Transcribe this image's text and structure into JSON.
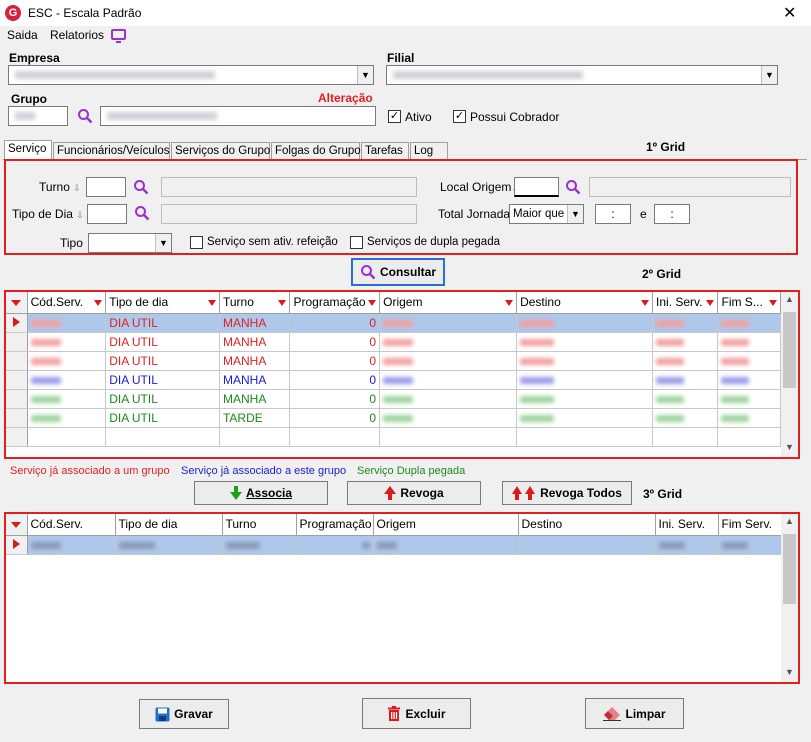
{
  "window": {
    "title": "ESC - Escala Padrão",
    "app_icon_letter": "G",
    "close_glyph": "✕"
  },
  "menu": {
    "items": [
      "Saida",
      "Relatorios"
    ]
  },
  "header": {
    "empresa_label": "Empresa",
    "filial_label": "Filial",
    "grupo_label": "Grupo",
    "alteracao_label": "Alteração",
    "ativo_label": "Ativo",
    "ativo_checked": true,
    "possui_cobrador_label": "Possui Cobrador",
    "possui_cobrador_checked": true
  },
  "tabs": [
    "Serviço",
    "Funcionários/Veículos",
    "Serviços do Grupo",
    "Folgas do Grupo",
    "Tarefas",
    "Log"
  ],
  "active_tab": "Serviço",
  "filters": {
    "grid_label": "1º Grid",
    "turno_label": "Turno",
    "tipo_dia_label": "Tipo de Dia",
    "tipo_label": "Tipo",
    "local_origem_label": "Local Origem",
    "total_jornada_label": "Total Jornada",
    "total_jornada_operator": "Maior que",
    "time_from": ":",
    "e_label": "e",
    "time_to": ":",
    "sem_ativ_label": "Serviço sem ativ. refeição",
    "dupla_pegada_label": "Serviços de dupla pegada"
  },
  "consultar_label": "Consultar",
  "grid2": {
    "label": "2º Grid",
    "columns": [
      "Cód.Serv.",
      "Tipo de dia",
      "Turno",
      "Programação",
      "Origem",
      "Destino",
      "Ini. Serv.",
      "Fim S..."
    ],
    "rows": [
      {
        "tipo": "DIA UTIL",
        "turno": "MANHA",
        "prog": "0",
        "color": "red",
        "selected": true
      },
      {
        "tipo": "DIA UTIL",
        "turno": "MANHA",
        "prog": "0",
        "color": "red",
        "selected": false
      },
      {
        "tipo": "DIA UTIL",
        "turno": "MANHA",
        "prog": "0",
        "color": "red",
        "selected": false
      },
      {
        "tipo": "DIA UTIL",
        "turno": "MANHA",
        "prog": "0",
        "color": "blue",
        "selected": false
      },
      {
        "tipo": "DIA UTIL",
        "turno": "MANHA",
        "prog": "0",
        "color": "green",
        "selected": false
      },
      {
        "tipo": "DIA UTIL",
        "turno": "TARDE",
        "prog": "0",
        "color": "green",
        "selected": false
      }
    ]
  },
  "legend": {
    "red": "Serviço já associado a um grupo",
    "blue": "Serviço já associado a este grupo",
    "green": "Serviço Dupla pegada"
  },
  "actions": {
    "associa": "Associa",
    "revoga": "Revoga",
    "revoga_todos": "Revoga Todos",
    "grid3_label": "3º Grid"
  },
  "grid3": {
    "columns": [
      "Cód.Serv.",
      "Tipo de dia",
      "Turno",
      "Programação",
      "Origem",
      "Destino",
      "Ini. Serv.",
      "Fim Serv."
    ]
  },
  "footer": {
    "gravar": "Gravar",
    "excluir": "Excluir",
    "limpar": "Limpar"
  },
  "colors": {
    "accent_red": "#e02020",
    "focus_blue": "#2a6fd6",
    "search_icon": "#9b2fd1",
    "row_red": "#e02020",
    "row_blue": "#1b1bd6",
    "row_green": "#1a8a1a"
  }
}
